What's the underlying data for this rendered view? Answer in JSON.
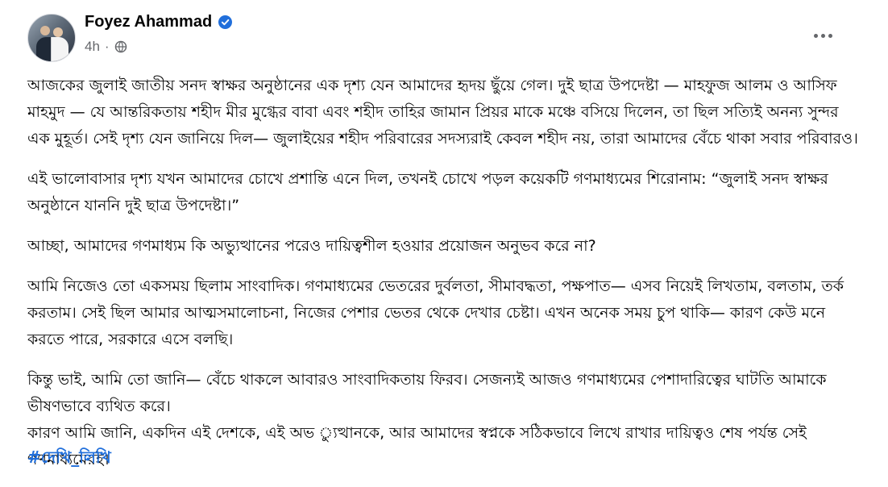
{
  "post": {
    "author": "Foyez Ahammad",
    "timestamp": "4h",
    "verified_icon": "verified-badge-icon",
    "audience_icon": "globe-icon",
    "more_icon": "more-options-icon",
    "accent_color": "#216fdb",
    "paragraphs": [
      "আজকের জুলাই জাতীয় সনদ স্বাক্ষর অনুষ্ঠানের এক দৃশ্য যেন আমাদের হৃদয় ছুঁয়ে গেল। দুই ছাত্র উপদেষ্টা — মাহফুজ আলম ও আসিফ মাহমুদ — যে আন্তরিকতায় শহীদ মীর মুগ্ধের বাবা এবং শহীদ তাহির জামান প্রিয়র মাকে মঞ্চে বসিয়ে দিলেন, তা ছিল সত্যিই অনন্য সুন্দর এক মুহূর্ত। সেই দৃশ্য যেন জানিয়ে দিল— জুলাইয়ের শহীদ পরিবারের সদস্যরাই কেবল শহীদ নয়, তারা আমাদের বেঁচে থাকা সবার পরিবারও।",
      "এই ভালোবাসার দৃশ্য যখন আমাদের চোখে প্রশান্তি এনে দিল, তখনই চোখে পড়ল কয়েকটি গণমাধ্যমের শিরোনাম: “জুলাই সনদ স্বাক্ষর অনুষ্ঠানে যাননি দুই ছাত্র উপদেষ্টা।”",
      "আচ্ছা, আমাদের গণমাধ্যম কি অভ্যুত্থানের পরেও দায়িত্বশীল হওয়ার প্রয়োজন অনুভব করে না?",
      "আমি নিজেও তো একসময় ছিলাম সাংবাদিক। গণমাধ্যমের ভেতরের দুর্বলতা, সীমাবদ্ধতা, পক্ষপাত— এসব নিয়েই লিখতাম, বলতাম, তর্ক করতাম। সেই ছিল আমার আত্মসমালোচনা, নিজের পেশার ভেতর থেকে দেখার চেষ্টা। এখন অনেক সময় চুপ থাকি— কারণ কেউ মনে করতে পারে, সরকারে এসে বলছি।",
      "কিন্তু ভাই, আমি তো জানি— বেঁচে থাকলে আবারও সাংবাদিকতায় ফিরব। সেজন্যই আজও গণমাধ্যমের পেশাদারিত্বের ঘাটতি আমাকে ভীষণভাবে ব্যথিত করে।",
      "কারণ আমি জানি, একদিন এই দেশকে, এই অভ ্যুত্থানকে, আর আমাদের স্বপ্নকে সঠিকভাবে লিখে রাখার দায়িত্বও শেষ পর্যন্ত সেই গণমাধ্যমেরই।"
    ],
    "hashtag": "#দেখি_লিখি"
  }
}
